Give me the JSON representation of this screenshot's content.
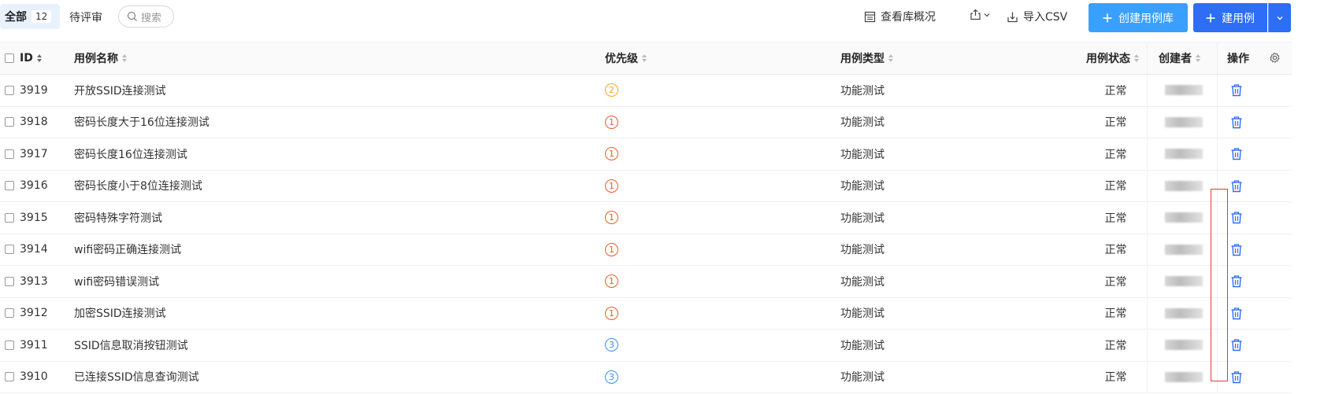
{
  "toolbar": {
    "tab_all_label": "全部",
    "tab_all_count": "12",
    "tab_review_label": "待评审",
    "search_placeholder": "搜索",
    "overview_label": "查看库概况",
    "import_label": "导入CSV",
    "create_library_label": "创建用例库",
    "create_case_label": "建用例"
  },
  "table": {
    "headers": {
      "id": "ID",
      "name": "用例名称",
      "priority": "优先级",
      "type": "用例类型",
      "status": "用例状态",
      "creator": "创建者",
      "actions": "操作"
    },
    "rows": [
      {
        "id": "3919",
        "name": "开放SSID连接测试",
        "priority": "2",
        "type": "功能测试",
        "status": "正常"
      },
      {
        "id": "3918",
        "name": "密码长度大于16位连接测试",
        "priority": "1",
        "type": "功能测试",
        "status": "正常"
      },
      {
        "id": "3917",
        "name": "密码长度16位连接测试",
        "priority": "1",
        "type": "功能测试",
        "status": "正常"
      },
      {
        "id": "3916",
        "name": "密码长度小于8位连接测试",
        "priority": "1",
        "type": "功能测试",
        "status": "正常"
      },
      {
        "id": "3915",
        "name": "密码特殊字符测试",
        "priority": "1",
        "type": "功能测试",
        "status": "正常"
      },
      {
        "id": "3914",
        "name": "wifi密码正确连接测试",
        "priority": "1",
        "type": "功能测试",
        "status": "正常"
      },
      {
        "id": "3913",
        "name": "wifi密码错误测试",
        "priority": "1",
        "type": "功能测试",
        "status": "正常"
      },
      {
        "id": "3912",
        "name": "加密SSID连接测试",
        "priority": "1",
        "type": "功能测试",
        "status": "正常"
      },
      {
        "id": "3911",
        "name": "SSID信息取消按钮测试",
        "priority": "3",
        "type": "功能测试",
        "status": "正常"
      },
      {
        "id": "3910",
        "name": "已连接SSID信息查询测试",
        "priority": "3",
        "type": "功能测试",
        "status": "正常"
      }
    ]
  },
  "colors": {
    "priority_1": "#f05a28",
    "priority_2": "#f5a623",
    "priority_3": "#3d8ef0",
    "delete_icon": "#2e6ef5",
    "primary": "#2e6ef5",
    "primary_light": "#3aa0ff",
    "annotation_box": "#e53935"
  },
  "icons": {
    "search": "search-icon",
    "overview": "table-icon",
    "export": "share-icon",
    "import": "download-icon",
    "add": "plus-icon",
    "dropdown": "chevron-down-icon",
    "sort": "sort-icon",
    "settings": "gear-icon",
    "delete": "trash-icon"
  }
}
